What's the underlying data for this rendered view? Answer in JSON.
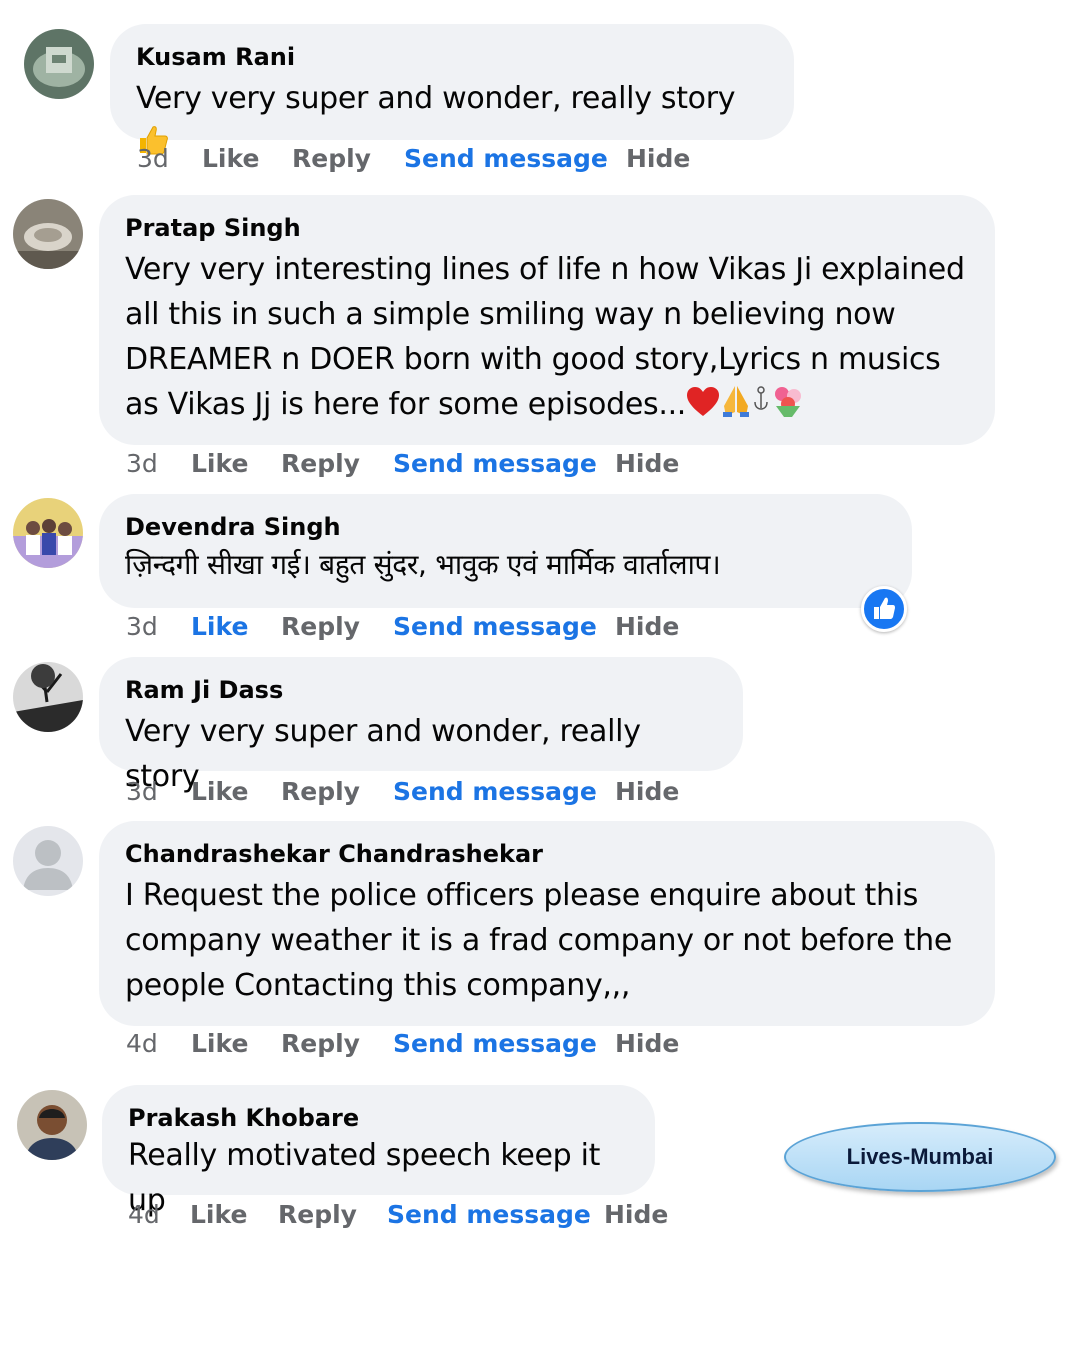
{
  "comments": [
    {
      "author": "Kusam Rani",
      "text": "Very very super and wonder, really story",
      "time": "3d",
      "actions": {
        "like": "Like",
        "reply": "Reply",
        "send": "Send message",
        "hide": "Hide"
      }
    },
    {
      "author": "Pratap Singh",
      "text": "Very very interesting lines of life n how Vikas Ji explained all this in such a simple smiling way n believing now DREAMER n DOER born with good story,Lyrics n musics as Vikas Jj is here for some episodes...",
      "time": "3d",
      "actions": {
        "like": "Like",
        "reply": "Reply",
        "send": "Send message",
        "hide": "Hide"
      }
    },
    {
      "author": "Devendra Singh",
      "text": "ज़िन्दगी सीखा गई। बहुत सुंदर, भावुक एवं मार्मिक वार्तालाप।",
      "time": "3d",
      "liked": true,
      "actions": {
        "like": "Like",
        "reply": "Reply",
        "send": "Send message",
        "hide": "Hide"
      }
    },
    {
      "author": "Ram Ji Dass",
      "text": "Very very super and wonder, really story",
      "time": "3d",
      "actions": {
        "like": "Like",
        "reply": "Reply",
        "send": "Send message",
        "hide": "Hide"
      }
    },
    {
      "author": "Chandrashekar Chandrashekar",
      "text": "I Request the police officers please enquire about this company weather it is a frad company or not before the people Contacting this company,,,",
      "time": "4d",
      "actions": {
        "like": "Like",
        "reply": "Reply",
        "send": "Send message",
        "hide": "Hide"
      }
    },
    {
      "author": "Prakash Khobare",
      "text": "Really motivated speech keep it up",
      "time": "4d",
      "actions": {
        "like": "Like",
        "reply": "Reply",
        "send": "Send message",
        "hide": "Hide"
      }
    }
  ],
  "reaction_badge_icon": "thumbs-up-icon",
  "colors": {
    "bubble": "#f0f2f5",
    "meta": "#65676b",
    "link_blue": "#1b74e4",
    "like_badge": "#1877f2"
  },
  "brand_label": "Lives-Mumbai"
}
